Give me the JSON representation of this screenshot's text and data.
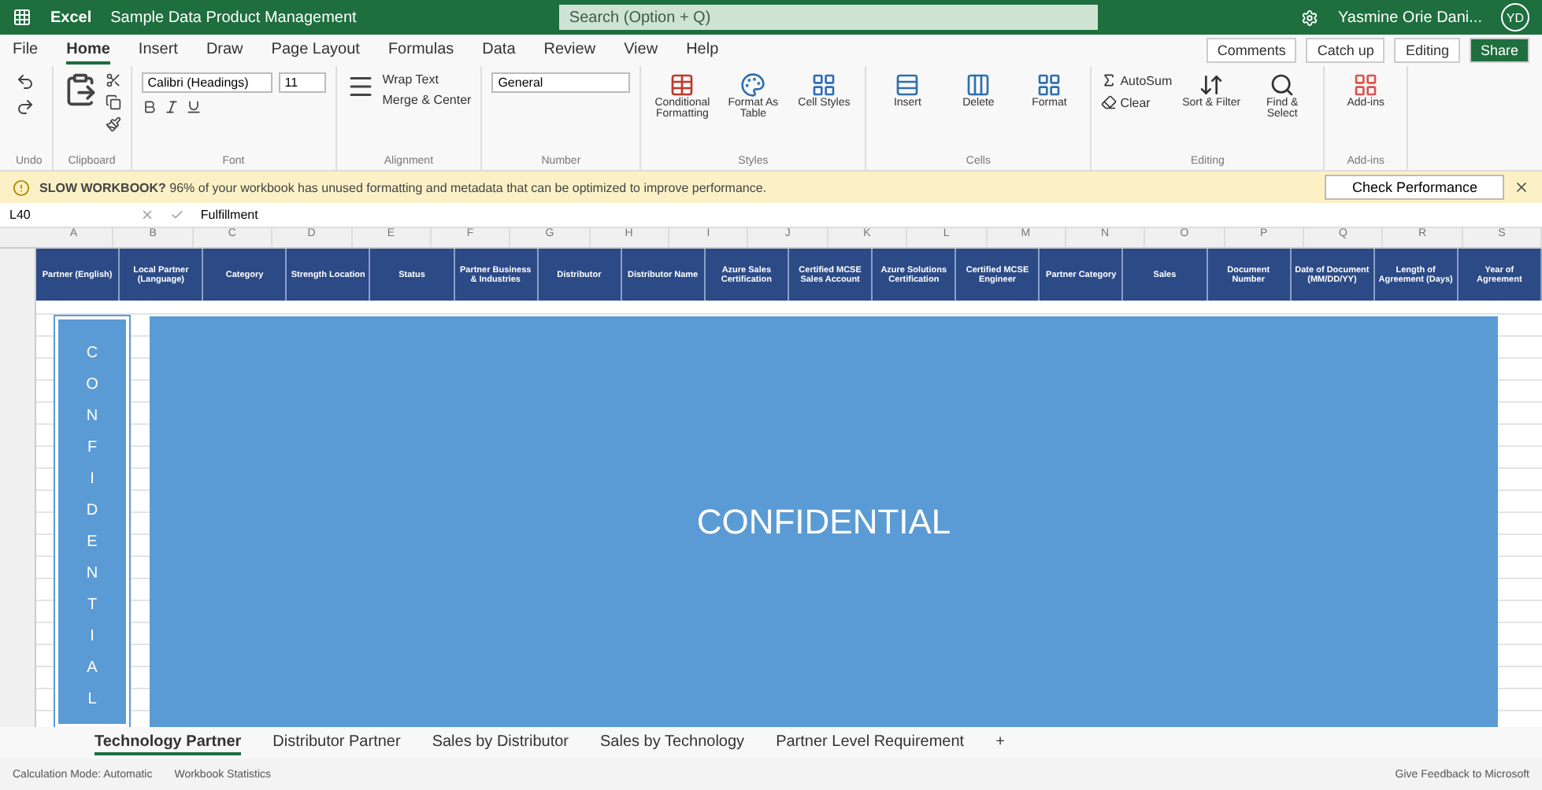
{
  "title_bar": {
    "app": "Excel",
    "document": "Sample Data Product Management",
    "search": {
      "placeholder": "Search (Option + Q)"
    },
    "user": "Yasmine Orie Dani...",
    "initials": "YD"
  },
  "menu_tabs": [
    {
      "label": "File",
      "selected": false
    },
    {
      "label": "Home",
      "selected": true
    },
    {
      "label": "Insert",
      "selected": false
    },
    {
      "label": "Draw",
      "selected": false
    },
    {
      "label": "Page Layout",
      "selected": false
    },
    {
      "label": "Formulas",
      "selected": false
    },
    {
      "label": "Data",
      "selected": false
    },
    {
      "label": "Review",
      "selected": false
    },
    {
      "label": "View",
      "selected": false
    },
    {
      "label": "Help",
      "selected": false
    }
  ],
  "top_actions": [
    "Comments",
    "Catch up",
    "Editing",
    "Share"
  ],
  "ribbon": {
    "font_name": "Calibri (Headings)",
    "font_size": "11",
    "wrap_text": "Wrap Text",
    "merge": "Merge & Center",
    "number_format": "General",
    "styles": [
      "Conditional Formatting",
      "Format As Table",
      "Cell Styles"
    ],
    "cells": [
      "Insert",
      "Delete",
      "Format"
    ],
    "autosum": "AutoSum",
    "clear": "Clear",
    "editing": [
      "Sort & Filter",
      "Find & Select"
    ],
    "addins": "Add-ins",
    "groups": [
      "Undo",
      "Clipboard",
      "Font",
      "Alignment",
      "Number",
      "Styles",
      "Cells",
      "Editing",
      "Add-ins"
    ]
  },
  "banner": {
    "text": "**SLOW WORKBOOK?** 96% of your workbook has unused formatting and metadata that can be optimized to improve performance.",
    "button": "Check Performance"
  },
  "formula_bar": {
    "name_box": "L40",
    "formula": "Fulfillment"
  },
  "column_letters": [
    "A",
    "B",
    "C",
    "D",
    "E",
    "F",
    "G",
    "H",
    "I",
    "J",
    "K",
    "L",
    "M",
    "N",
    "O",
    "P",
    "Q",
    "R",
    "S"
  ],
  "table": {
    "columns": [
      "Partner (English)",
      "Local Partner (Language)",
      "Category",
      "Strength Location",
      "Status",
      "Partner Business & Industries",
      "Distributor",
      "Distributor Name",
      "Azure Sales Certification",
      "Certified MCSE Sales Account",
      "Azure Solutions Certification",
      "Certified MCSE Engineer",
      "Partner Category",
      "Sales",
      "Document Number",
      "Date of Document (MM/DD/YY)",
      "Length of Agreement (Days)",
      "Year of Agreement"
    ]
  },
  "overlays": {
    "vertical": "CONFIDENTIAL",
    "main": "CONFIDENTIAL"
  },
  "sheet_tabs": [
    {
      "label": "Technology Partner",
      "selected": true
    },
    {
      "label": "Distributor Partner",
      "selected": false
    },
    {
      "label": "Sales by Distributor",
      "selected": false
    },
    {
      "label": "Sales by Technology",
      "selected": false
    },
    {
      "label": "Partner Level Requirement",
      "selected": false
    }
  ],
  "add_sheet": "+",
  "status_bar": {
    "left": [
      "Calculation Mode: Automatic",
      "Workbook Statistics"
    ],
    "feedback": "Give Feedback to Microsoft"
  }
}
